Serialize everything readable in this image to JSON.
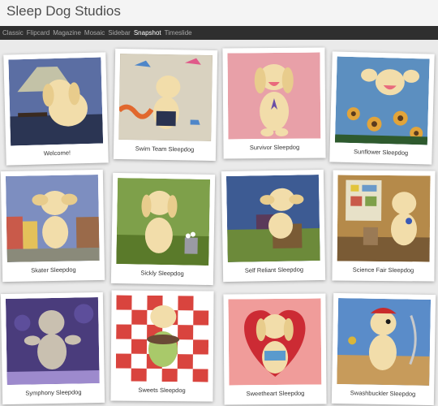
{
  "site": {
    "title": "Sleep Dog Studios"
  },
  "nav": {
    "items": [
      {
        "label": "Classic"
      },
      {
        "label": "Flipcard"
      },
      {
        "label": "Magazine"
      },
      {
        "label": "Mosaic"
      },
      {
        "label": "Sidebar"
      },
      {
        "label": "Snapshot"
      },
      {
        "label": "Timeslide"
      }
    ],
    "active": "Snapshot"
  },
  "gallery": {
    "cards": [
      {
        "title": "Welcome!",
        "bg": "#5b6ea3",
        "accent": "#2b3553"
      },
      {
        "title": "Swim Team Sleepdog",
        "bg": "#d9d2c0",
        "accent": "#4e86c9"
      },
      {
        "title": "Survivor Sleepdog",
        "bg": "#e8a0a8",
        "accent": "#d67d89"
      },
      {
        "title": "Sunflower Sleepdog",
        "bg": "#5c8fc0",
        "accent": "#e2a43a"
      },
      {
        "title": "Skater Sleepdog",
        "bg": "#7d8ec0",
        "accent": "#c95a4a"
      },
      {
        "title": "Sickly Sleepdog",
        "bg": "#7ea04a",
        "accent": "#e0c06a"
      },
      {
        "title": "Self Reliant Sleepdog",
        "bg": "#3d5b93",
        "accent": "#6c8a3a"
      },
      {
        "title": "Science Fair Sleepdog",
        "bg": "#b58a4a",
        "accent": "#7a5b35"
      },
      {
        "title": "Symphony Sleepdog",
        "bg": "#4a3c7c",
        "accent": "#9d8acd"
      },
      {
        "title": "Sweets Sleepdog",
        "bg": "#d9443e",
        "accent": "#ffffff"
      },
      {
        "title": "Sweetheart Sleepdog",
        "bg": "#f09c9a",
        "accent": "#cc2b34"
      },
      {
        "title": "Swashbuckler Sleepdog",
        "bg": "#5a8cc9",
        "accent": "#c79b5b"
      }
    ]
  }
}
